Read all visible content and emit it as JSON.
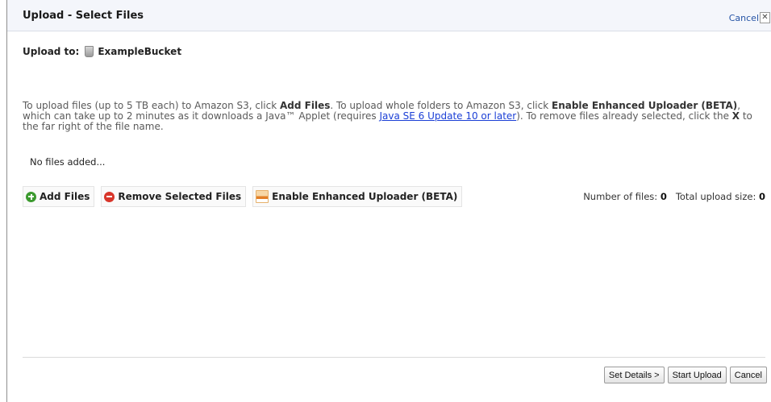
{
  "dialog": {
    "title": "Upload - Select Files",
    "cancel_link": "Cancel",
    "close_glyph": "✕"
  },
  "upload_to": {
    "label": "Upload to:",
    "bucket_icon": "bucket-icon",
    "bucket_name": "ExampleBucket"
  },
  "instructions": {
    "p1": "To upload files (up to 5 TB each) to Amazon S3, click ",
    "b1": "Add Files",
    "p2": ". To upload whole folders to Amazon S3, click ",
    "b2": "Enable Enhanced Uploader (BETA)",
    "p3": ", which can take up to 2 minutes as it downloads a Java™ Applet (requires ",
    "link": "Java SE 6 Update 10 or later",
    "p4": "). To remove files already selected, click the ",
    "b3": "X",
    "p5": " to the far right of the file name."
  },
  "file_list": {
    "empty_text": "No files added..."
  },
  "toolbar": {
    "add_files": "Add Files",
    "remove_selected": "Remove Selected Files",
    "enhanced_uploader": "Enable Enhanced Uploader (BETA)",
    "icons": {
      "add": "add-circle-icon",
      "remove": "remove-circle-icon",
      "java": "java-icon"
    }
  },
  "stats": {
    "files_label": "Number of files:",
    "files_value": "0",
    "size_label": "Total upload size:",
    "size_value": "0"
  },
  "footer": {
    "set_details": "Set Details >",
    "start_upload": "Start Upload",
    "cancel": "Cancel"
  },
  "colors": {
    "titlebar_bg": "#f4f6fb",
    "link": "#1b3fd6",
    "add_icon": "#3c9a2f",
    "remove_icon": "#d8352a"
  }
}
